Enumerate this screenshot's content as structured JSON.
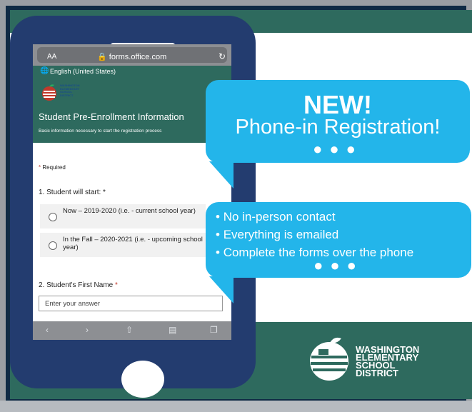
{
  "browser": {
    "text_size": "AA",
    "url": "forms.office.com",
    "language": "English (United States)"
  },
  "form": {
    "logo_text": [
      "WASHINGTON",
      "ELEMENTARY",
      "SCHOOL",
      "DISTRICT"
    ],
    "title": "Student Pre-Enrollment Information",
    "subtitle": "Basic information necessary to start the registration process",
    "required_note": "Required",
    "q1": "1. Student will start:",
    "options": [
      "Now – 2019-2020 (i.e. - current school year)",
      "In the Fall – 2020-2021 (i.e. - upcoming school year)"
    ],
    "q2": "2. Student's First Name",
    "answer_placeholder": "Enter your answer"
  },
  "promo": {
    "headline": "NEW!",
    "subheadline": "Phone-in Registration!",
    "bullets": [
      "No in-person contact",
      "Everything is emailed",
      "Complete the forms over the phone"
    ]
  },
  "district": {
    "name_lines": [
      "WASHINGTON",
      "ELEMENTARY",
      "SCHOOL",
      "DISTRICT"
    ]
  },
  "colors": {
    "teal": "#2e6a5e",
    "navy_phone": "#233c6f",
    "bubble_blue": "#23b5ea"
  }
}
